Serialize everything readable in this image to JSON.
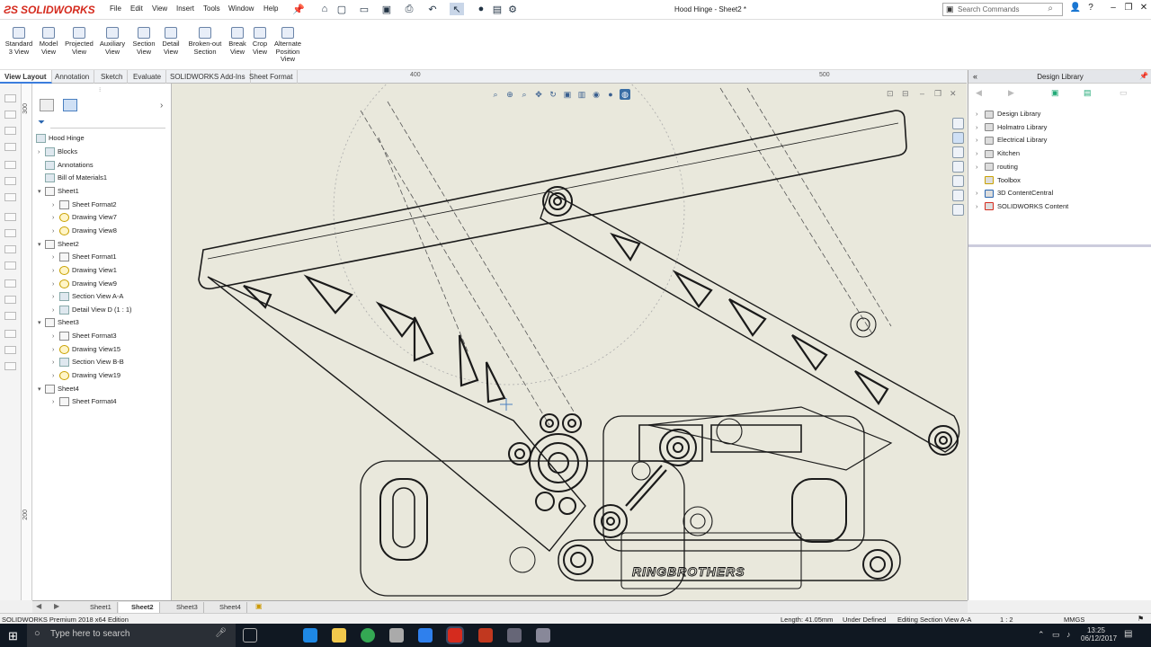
{
  "app": {
    "logo_text": "SOLIDWORKS",
    "document_title": "Hood Hinge - Sheet2 *"
  },
  "menu": [
    "File",
    "Edit",
    "View",
    "Insert",
    "Tools",
    "Window",
    "Help"
  ],
  "search": {
    "placeholder": "Search Commands"
  },
  "command_manager": {
    "tools": [
      "Standard 3 View",
      "Model View",
      "Projected View",
      "Auxiliary View",
      "Section View",
      "Detail View",
      "Broken-out Section",
      "Break View",
      "Crop View",
      "Alternate Position View"
    ]
  },
  "tabs": [
    "View Layout",
    "Annotation",
    "Sketch",
    "Evaluate",
    "SOLIDWORKS Add-Ins",
    "Sheet Format"
  ],
  "ruler": {
    "h1": "400",
    "h2": "500",
    "v1": "300",
    "v2": "200"
  },
  "feature_tree": {
    "root": "Hood Hinge",
    "items": [
      {
        "label": "Blocks",
        "level": 1,
        "icon": "folder"
      },
      {
        "label": "Annotations",
        "level": 1,
        "icon": "annot"
      },
      {
        "label": "Bill of Materials1",
        "level": 1,
        "icon": "bom"
      },
      {
        "label": "Sheet1",
        "level": 1,
        "icon": "sheet"
      },
      {
        "label": "Sheet Format2",
        "level": 2,
        "icon": "sheet"
      },
      {
        "label": "Drawing View7",
        "level": 2,
        "icon": "draw"
      },
      {
        "label": "Drawing View8",
        "level": 2,
        "icon": "draw"
      },
      {
        "label": "Sheet2",
        "level": 1,
        "icon": "sheet"
      },
      {
        "label": "Sheet Format1",
        "level": 2,
        "icon": "sheet"
      },
      {
        "label": "Drawing View1",
        "level": 2,
        "icon": "draw"
      },
      {
        "label": "Drawing View9",
        "level": 2,
        "icon": "draw"
      },
      {
        "label": "Section View A-A",
        "level": 2,
        "icon": "section"
      },
      {
        "label": "Detail View D (1 : 1)",
        "level": 2,
        "icon": "detail"
      },
      {
        "label": "Sheet3",
        "level": 1,
        "icon": "sheet"
      },
      {
        "label": "Sheet Format3",
        "level": 2,
        "icon": "sheet"
      },
      {
        "label": "Drawing View15",
        "level": 2,
        "icon": "draw"
      },
      {
        "label": "Section View B-B",
        "level": 2,
        "icon": "section"
      },
      {
        "label": "Drawing View19",
        "level": 2,
        "icon": "draw"
      },
      {
        "label": "Sheet4",
        "level": 1,
        "icon": "sheet"
      },
      {
        "label": "Sheet Format4",
        "level": 2,
        "icon": "sheet"
      }
    ]
  },
  "design_library": {
    "title": "Design Library",
    "items": [
      "Design Library",
      "Holmatro Library",
      "Electrical Library",
      "Kitchen",
      "routing",
      "Toolbox",
      "3D ContentCentral",
      "SOLIDWORKS Content"
    ]
  },
  "drawing": {
    "logo_text": "RINGBROTHERS"
  },
  "sheet_tabs": [
    "Sheet1",
    "Sheet2",
    "Sheet3",
    "Sheet4"
  ],
  "active_sheet": "Sheet2",
  "status": {
    "edition": "SOLIDWORKS Premium 2018 x64 Edition",
    "length": "Length: 41.05mm",
    "state": "Under Defined",
    "editing": "Editing Section View A-A",
    "scale": "1 : 2",
    "units": "MMGS"
  },
  "taskbar": {
    "search_placeholder": "Type here to search",
    "time": "13:25",
    "date": "06/12/2017"
  }
}
